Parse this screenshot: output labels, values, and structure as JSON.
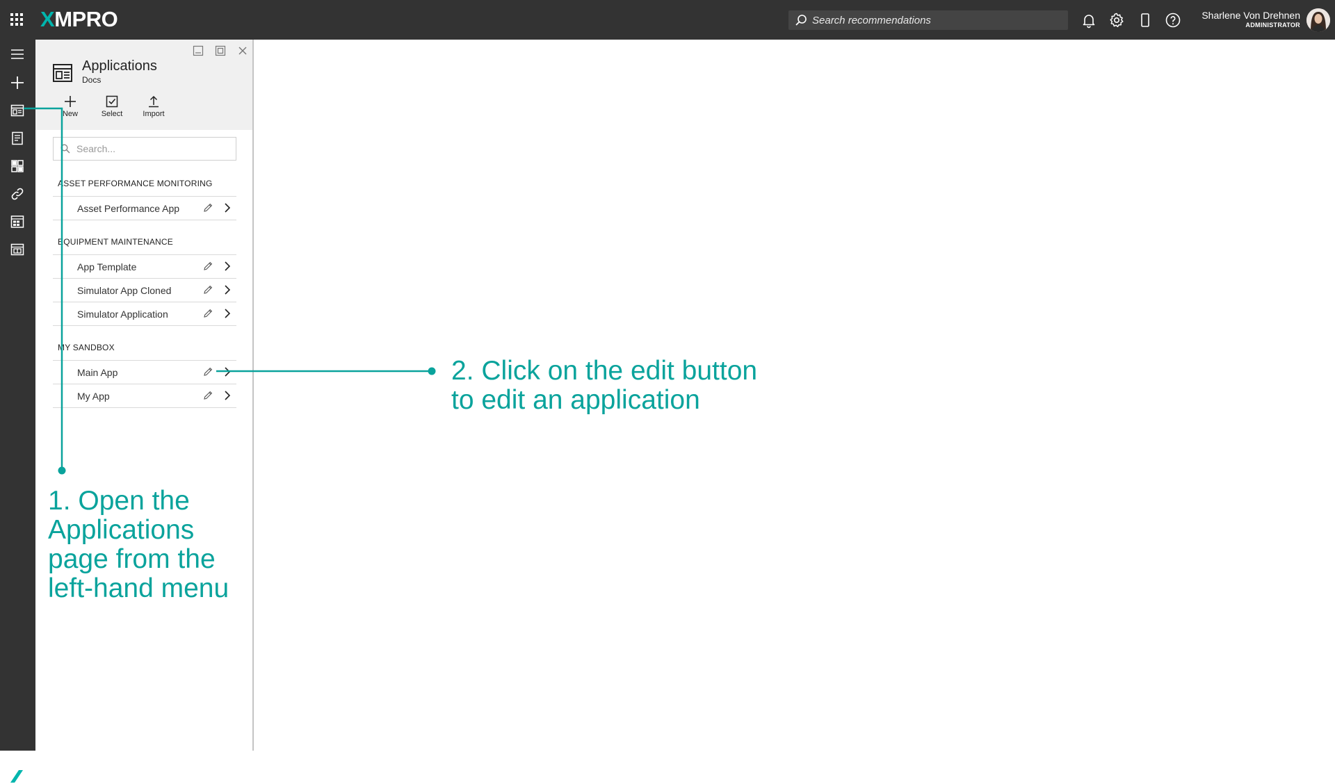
{
  "topbar": {
    "logo_prefix": "X",
    "logo_rest": "MPRO",
    "search_placeholder": "Search recommendations",
    "icons": [
      "apps-grid-icon",
      "bell-icon",
      "gear-icon",
      "mobile-icon",
      "help-icon"
    ],
    "user_name": "Sharlene Von Drehnen",
    "user_role": "ADMINISTRATOR"
  },
  "rail": {
    "icons": [
      "menu-icon",
      "add-icon",
      "applications-icon",
      "recommendations-icon",
      "dashboard-icon",
      "link-icon",
      "data-stream-icon",
      "integration-icon"
    ],
    "bottom_logo": "X"
  },
  "blade": {
    "title": "Applications",
    "subtitle": "Docs",
    "toolbar": {
      "new_label": "New",
      "select_label": "Select",
      "import_label": "Import"
    },
    "search_placeholder": "Search...",
    "groups": [
      {
        "heading": "ASSET PERFORMANCE MONITORING",
        "items": [
          "Asset Performance App"
        ]
      },
      {
        "heading": "EQUIPMENT MAINTENANCE",
        "items": [
          "App Template",
          "Simulator App Cloned",
          "Simulator Application"
        ]
      },
      {
        "heading": "MY SANDBOX",
        "items": [
          "Main App",
          "My App"
        ]
      }
    ]
  },
  "annotations": {
    "step1_lines": [
      "1. Open the",
      "Applications",
      "page from the",
      "left-hand menu"
    ],
    "step2_lines": [
      "2. Click on the edit button",
      "to edit an application"
    ],
    "accent_color": "#0aa39c"
  }
}
